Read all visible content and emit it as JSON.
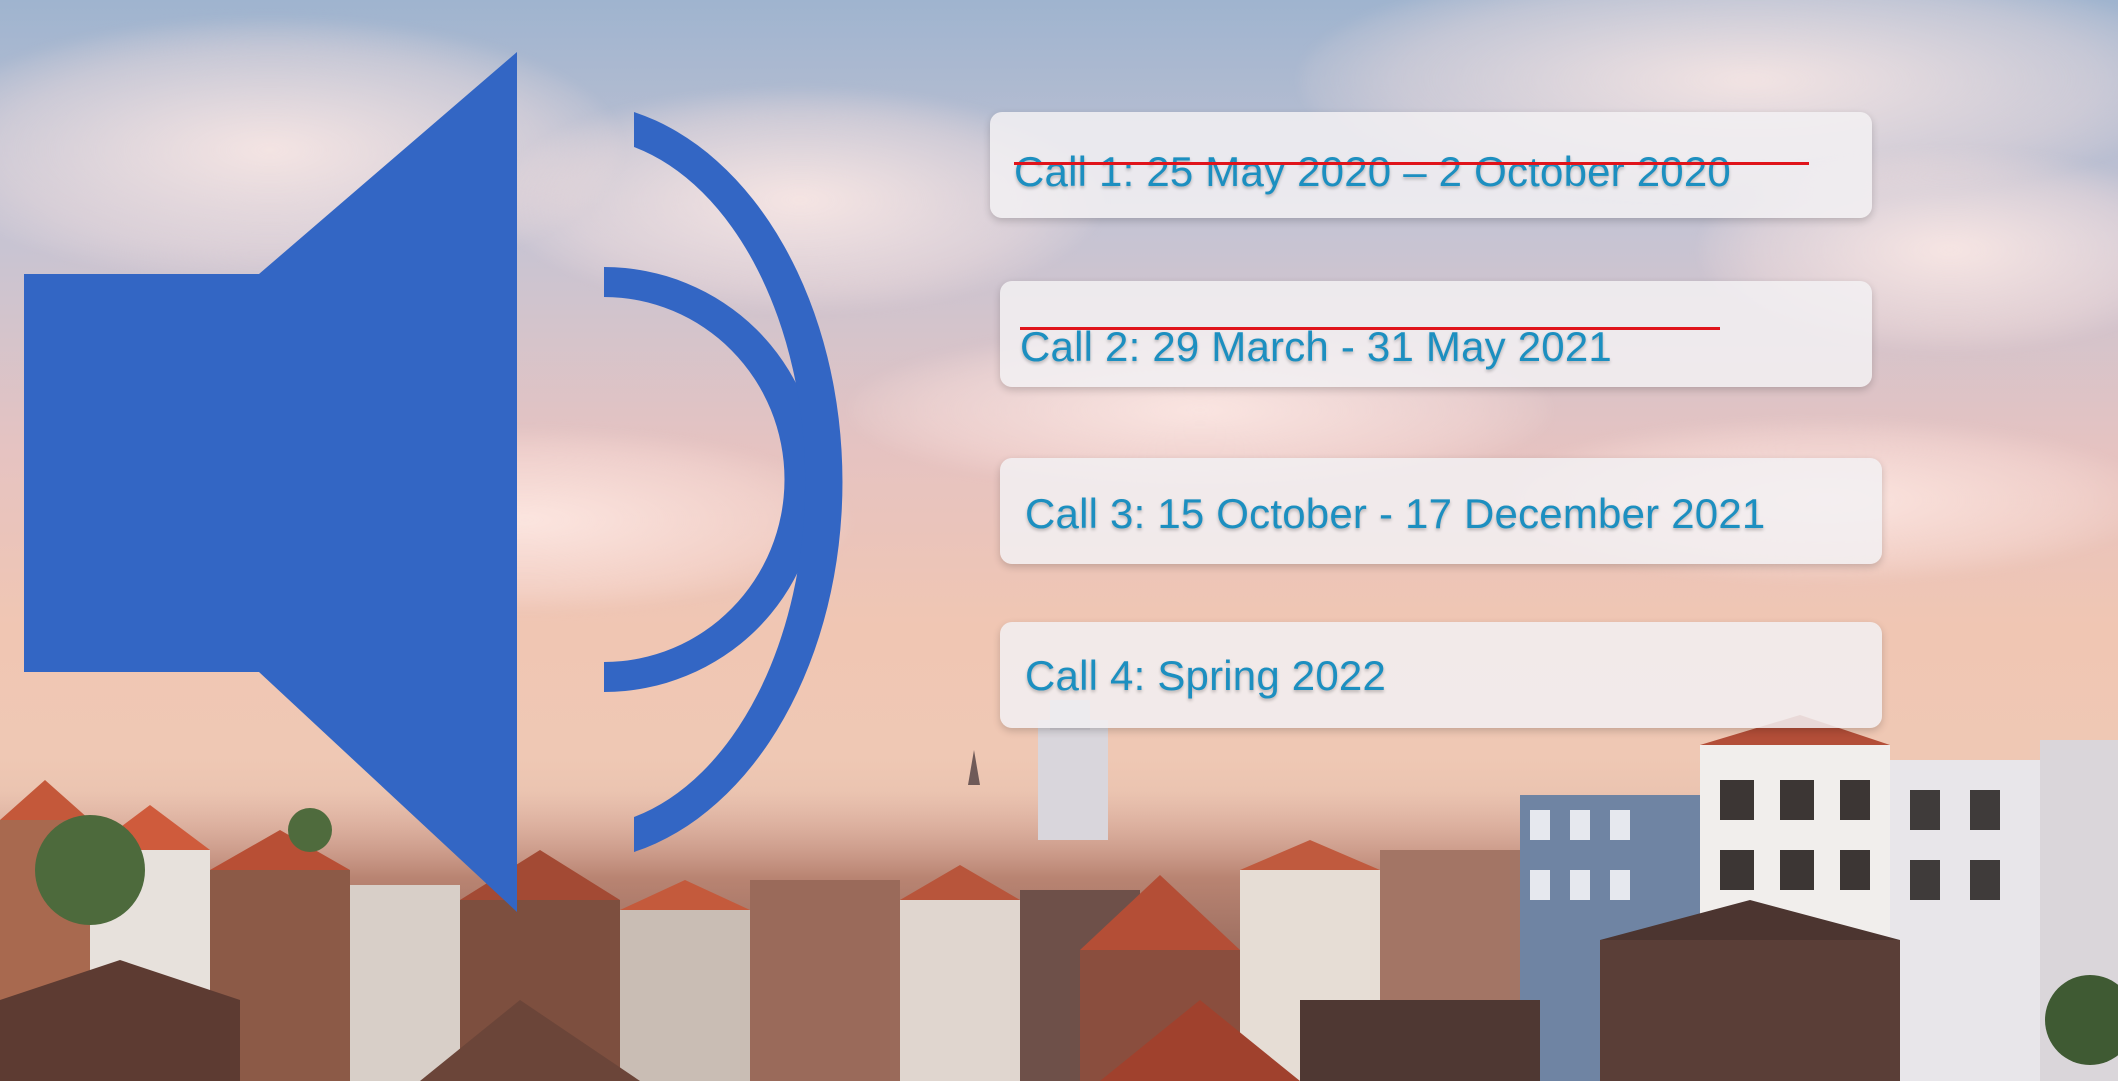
{
  "calls": [
    {
      "label": "Call 1: 25 May 2020 – 2 October 2020",
      "struck": true
    },
    {
      "label": "Call 2: 29 March - 31 May 2021",
      "struck": true
    },
    {
      "label": "Call 3: 15 October  - 17 December 2021",
      "struck": false
    },
    {
      "label": "Call 4: Spring 2022",
      "struck": false
    }
  ],
  "icons": {
    "speaker": "speaker-volume-icon"
  },
  "colors": {
    "speaker": "#3366c4",
    "call_text": "#1c8fc0",
    "strike": "#e0141b"
  }
}
